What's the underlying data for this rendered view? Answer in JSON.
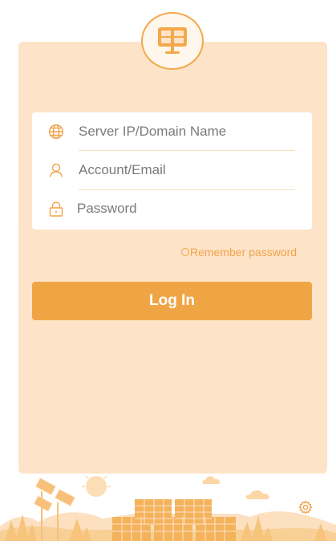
{
  "app": {
    "logo_icon": "solar-panel-icon",
    "accent_color": "#f0a545",
    "card_color": "#fde3c8"
  },
  "login_form": {
    "server": {
      "placeholder": "Server IP/Domain Name",
      "value": "",
      "icon": "globe-icon"
    },
    "account": {
      "placeholder": "Account/Email",
      "value": "",
      "icon": "user-icon"
    },
    "password": {
      "placeholder": "Password",
      "value": "",
      "icon": "lock-icon"
    },
    "remember_label": "Remember password",
    "remember_checked": false,
    "login_label": "Log In"
  },
  "footer": {
    "illustration": "solar-farm-illustration",
    "settings_icon": "gear-icon"
  }
}
